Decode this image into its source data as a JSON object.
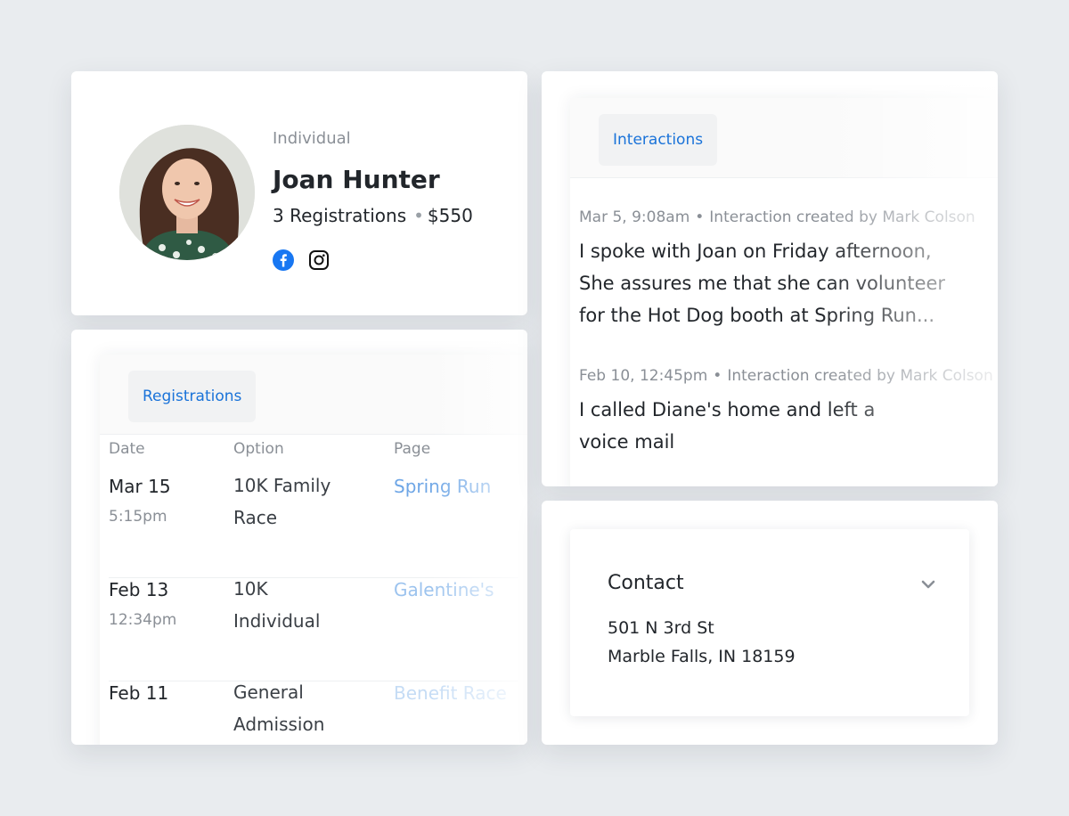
{
  "profile": {
    "type_label": "Individual",
    "name": "Joan Hunter",
    "registrations_count": "3 Registrations",
    "amount": "$550",
    "social": [
      "facebook-icon",
      "instagram-icon"
    ],
    "facebook_color": "#1877f2"
  },
  "registrations": {
    "tab_label": "Registrations",
    "columns": [
      "Date",
      "Option",
      "Page"
    ],
    "rows": [
      {
        "date": "Mar 15",
        "time": "5:15pm",
        "option": "10K Family Race",
        "page": "Spring Run"
      },
      {
        "date": "Feb 13",
        "time": "12:34pm",
        "option": "10K Individual",
        "page": "Galentine's"
      },
      {
        "date": "Feb 11",
        "time": "",
        "option": "General Admission",
        "page": "Benefit Race"
      }
    ]
  },
  "interactions": {
    "tab_label": "Interactions",
    "items": [
      {
        "date": "Mar 5, 9:08am",
        "meta": "Interaction created by Mark Colson",
        "text": "I spoke with Joan on Friday afternoon, She assures me that she can volunteer for the Hot Dog booth at Spring Run..."
      },
      {
        "date": "Feb 10, 12:45pm",
        "meta": "Interaction created by Mark Colson",
        "text": "I called Diane's home and left a voice mail"
      }
    ]
  },
  "contact": {
    "title": "Contact",
    "address_line1": "501 N 3rd St",
    "address_line2": "Marble Falls, IN 18159"
  },
  "colors": {
    "accent": "#1a73d9",
    "link": "#6ea6e6",
    "background": "#e9ecef"
  }
}
